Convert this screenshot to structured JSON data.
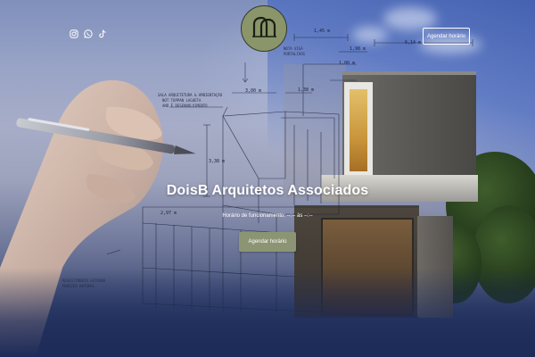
{
  "brand": {
    "logo_icon": "db-monogram-icon"
  },
  "header": {
    "social": [
      {
        "name": "instagram",
        "icon": "instagram-icon"
      },
      {
        "name": "whatsapp",
        "icon": "whatsapp-icon"
      },
      {
        "name": "tiktok",
        "icon": "tiktok-icon"
      }
    ],
    "cta_label": "Agendar horário"
  },
  "hero": {
    "title": "DoisB Arquitetos Associados",
    "hours_text": "Horário de funcionamento: --:-- às --:--",
    "cta_label": "Agendar horário"
  },
  "sketch": {
    "dims": [
      "1,45 m",
      "1,98 m",
      "6,14 m",
      "3,00 m",
      "1,38 m",
      "3,38 m",
      "2,97 m",
      "1,00 m"
    ],
    "notes": [
      "SALA ARQUITETURA & AMBIENTAÇÃO",
      "NOT TOPPAN LAGUETA",
      "AND É DESENVOLVIMENTO",
      "NOTA VIGA",
      "PORTALIVOS",
      "REVESTIMENTO EXTERNO",
      "MADEIRA NATURAL"
    ]
  },
  "colors": {
    "accent": "#8c9573",
    "logo_fill": "#8a956a",
    "text": "#ffffff"
  }
}
